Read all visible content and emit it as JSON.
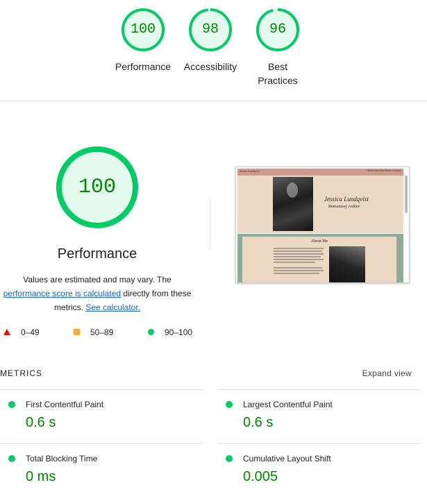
{
  "top_scores": [
    {
      "score": "100",
      "label_line1": "Performance",
      "label_line2": "",
      "fraction": 1.0
    },
    {
      "score": "98",
      "label_line1": "Accessibility",
      "label_line2": "",
      "fraction": 0.98
    },
    {
      "score": "96",
      "label_line1": "Best",
      "label_line2": "Practices",
      "fraction": 0.96
    }
  ],
  "performance": {
    "score": "100",
    "title": "Performance",
    "desc_part1": "Values are estimated and may vary. The",
    "desc_link1": "performance score is calculated",
    "desc_part2": "directly from these",
    "desc_part3": "metrics.",
    "desc_link2": "See calculator."
  },
  "legend": [
    {
      "range": "0–49",
      "color": "#eb0f00",
      "shape": "triangle"
    },
    {
      "range": "50–89",
      "color": "#ffaa33",
      "shape": "square"
    },
    {
      "range": "90–100",
      "color": "#00cc66",
      "shape": "circle"
    }
  ],
  "thumbnail": {
    "nav_title": "Jessica Lundqvist",
    "nav_links": "Home  About Me  Books  Contact",
    "name": "Jessica Lundqvist",
    "subtitle": "Romantasy Author",
    "about_title": "About Me"
  },
  "metrics": {
    "title": "METRICS",
    "expand_label": "Expand view",
    "items": [
      {
        "label": "First Contentful Paint",
        "value": "0.6 s"
      },
      {
        "label": "Largest Contentful Paint",
        "value": "0.6 s"
      },
      {
        "label": "Total Blocking Time",
        "value": "0 ms"
      },
      {
        "label": "Cumulative Layout Shift",
        "value": "0.005"
      }
    ]
  },
  "colors": {
    "pass_green": "#00cc66",
    "pass_text": "#008800",
    "pass_fill": "#e5faef",
    "link": "#1565c0"
  }
}
